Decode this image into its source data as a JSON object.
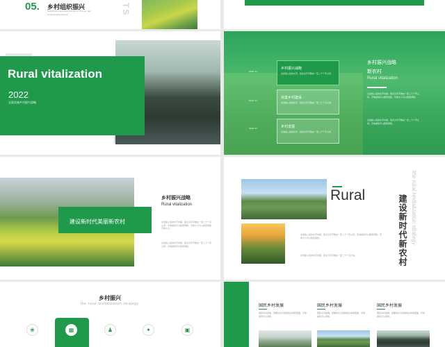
{
  "slide1": {
    "num": "05.",
    "title": "乡村组织振兴",
    "sub": "Sebahs a breahtrmeal contrulor in fhrnese, day implementiing rhobrod",
    "vertical": "TS"
  },
  "slide3": {
    "title": "Rural vitalization",
    "year": "2022",
    "sub": "全面实施乡村振兴战略"
  },
  "slide4": {
    "side_labels": [
      "PART 01",
      "PART 02",
      "PART 03"
    ],
    "boxes": [
      {
        "title": "乡村振兴战略",
        "text": "点击输入您的文字，建议文字字数在一至二十个字之间"
      },
      {
        "title": "完善乡村建设",
        "text": "点击输入您的文字，建议文字字数在一至二十个字之间"
      },
      {
        "title": "乡村发展",
        "text": "点击输入您的文字，建议文字字数在一至二十个字之间"
      }
    ],
    "right_title": "乡村振兴战略",
    "right_title2": "新农村",
    "right_en": "Rural vitalization",
    "p1": "点击输入您的文字内容，建议文字字数在一至二十个字之间，字体颜色可以随意调整，字体大小可以随意调整。",
    "p2": "点击输入您的文字内容，建议文字字数在一至二十个字之间，字体颜色可以随意调整。"
  },
  "slide5": {
    "banner": "建设新时代美丽新农村",
    "title": "乡村振兴战略",
    "en": "Rural vitalization",
    "p1": "点击输入您的文字内容，建议文字字数在一至二十个字之间，字体颜色可以随意调整，字体大小可以随意调整字体大小。",
    "p2": "点击输入您的文字内容，建议文字字数在一至二十个字之间，字体颜色可以随意调整。"
  },
  "slide6": {
    "title": "Rural",
    "vertical_cn": "建设新时代新农村",
    "vertical_en": "the rural revitalization strategy",
    "p1": "点击输入您的文字内容，建议文字字数在一至二十个字之间，字体颜色可以随意调整，字体大小可以随意调整。",
    "p2": "点击输入您的文字内容，建议文字字数在一至二十个字之间。"
  },
  "slide7": {
    "title": "乡村振兴",
    "en": "the rural revitalization strategy",
    "icons": [
      "leaf-icon",
      "grid-icon",
      "person-icon",
      "pin-icon",
      "tractor-icon"
    ]
  },
  "slide8": {
    "cols": [
      {
        "title": "国民乡村发展",
        "text": "国民乡村发展，想要将文字复制到文本框里面，字体颜色可以调整。"
      },
      {
        "title": "国民乡村发展",
        "text": "国民乡村发展，想要将文字复制到文本框里面，字体颜色可以调整。"
      },
      {
        "title": "国民乡村发展",
        "text": "国民乡村发展，想要将文字复制到文本框里面，字体颜色可以调整。"
      }
    ]
  },
  "colors": {
    "accent": "#1e9a4a"
  }
}
